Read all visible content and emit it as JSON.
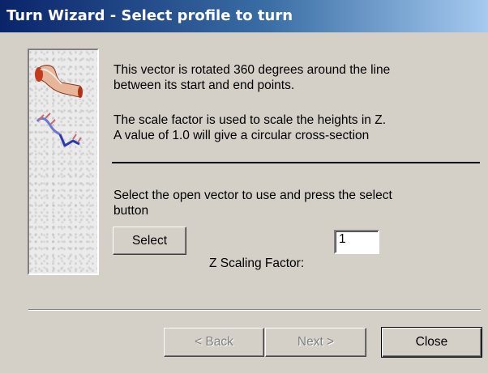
{
  "window": {
    "title": "Turn Wizard - Select profile to turn"
  },
  "description": {
    "line1": "This vector is rotated 360 degrees around the line",
    "line2": "between its start and end points.",
    "line3": "The scale factor is used to scale the heights in Z.",
    "line4": "A value of 1.0 will give a circular cross-section"
  },
  "instruction": {
    "line1": "Select the open vector to use and press the select",
    "line2": "button"
  },
  "select_button": {
    "label": "Select"
  },
  "z_scaling": {
    "label": "Z Scaling Factor:",
    "value": "1"
  },
  "footer": {
    "back_label": "< Back",
    "next_label": "Next >",
    "close_label": "Close"
  },
  "icons": {
    "turned_profile": "turned-solid-icon",
    "vector": "open-vector-icon"
  }
}
